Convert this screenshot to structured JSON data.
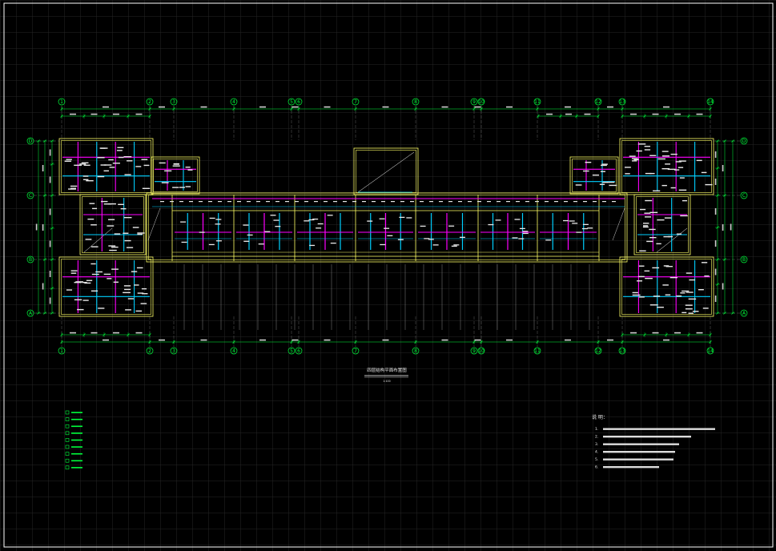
{
  "drawing": {
    "title": "四层结构平面布置图",
    "scale": "1:100",
    "grid_top": [
      "1",
      "2",
      "3",
      "4",
      "5",
      "6",
      "7",
      "8",
      "9",
      "10",
      "11",
      "12",
      "13",
      "14",
      "15"
    ],
    "grid_side": [
      "A",
      "B",
      "C",
      "D"
    ],
    "legend_items": [
      "",
      "",
      "",
      "",
      "",
      "",
      "",
      "",
      ""
    ],
    "notes_heading": "说 明：",
    "notes": [
      "1. ",
      "2. ",
      "3. ",
      "4. ",
      "5. ",
      "6. "
    ],
    "colors": {
      "background": "#000000",
      "grid": "#2a2a2a",
      "wall": "#ffff66",
      "beam_magenta": "#ff00ff",
      "beam_cyan": "#00d0ff",
      "axis": "#00ff3c",
      "dim": "#ffffff",
      "frame": "#ffffff"
    }
  }
}
